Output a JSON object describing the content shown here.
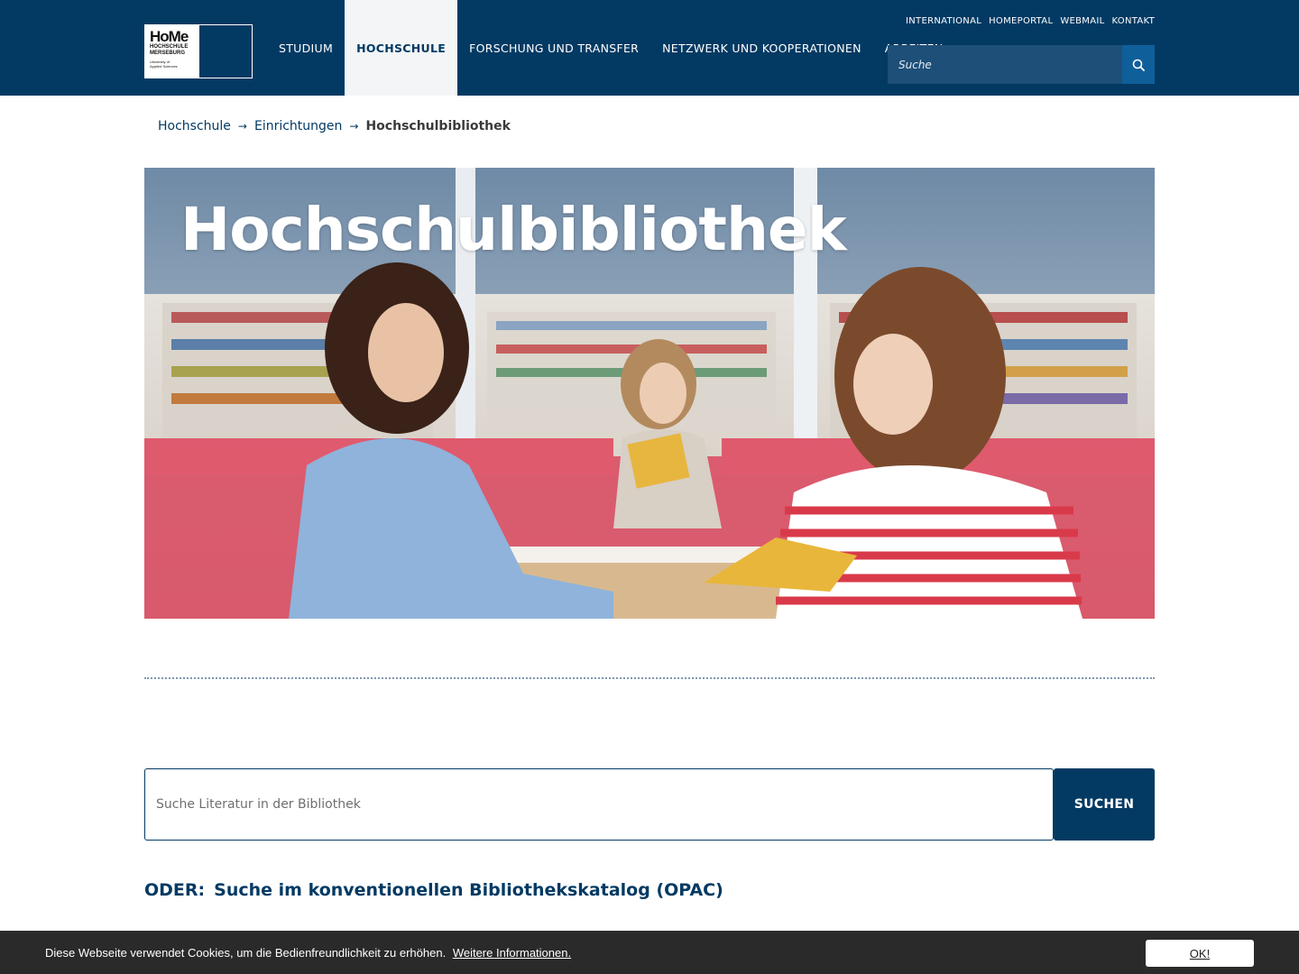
{
  "header": {
    "logo": {
      "title": "HoMe",
      "line1": "HOCHSCHULE",
      "line2": "MERSEBURG",
      "line3": "University of",
      "line4": "Applied Sciences"
    },
    "top_links": [
      "INTERNATIONAL",
      "HOMEPORTAL",
      "WEBMAIL",
      "KONTAKT"
    ],
    "main_nav": [
      {
        "label": "STUDIUM",
        "active": false
      },
      {
        "label": "HOCHSCHULE",
        "active": true
      },
      {
        "label": "FORSCHUNG UND TRANSFER",
        "active": false
      },
      {
        "label": "NETZWERK UND KOOPERATIONEN",
        "active": false
      },
      {
        "label": "ARBEITEN",
        "active": false
      }
    ],
    "search": {
      "placeholder": "Suche",
      "icon": "search-icon"
    }
  },
  "breadcrumb": {
    "items": [
      "Hochschule",
      "Einrichtungen"
    ],
    "current": "Hochschulbibliothek",
    "separator": "→"
  },
  "hero": {
    "title": "Hochschulbibliothek"
  },
  "library_search": {
    "placeholder": "Suche Literatur in der Bibliothek",
    "button": "SUCHEN"
  },
  "opac": {
    "prefix": "ODER:",
    "link": "Suche im konventionellen Bibliothekskatalog (OPAC)"
  },
  "cookie_bar": {
    "text": "Diese Webseite verwendet Cookies, um die Bedienfreundlichkeit zu erhöhen.",
    "link": "Weitere Informationen.",
    "button": "OK!"
  },
  "colors": {
    "primary": "#033a63",
    "search_bg": "#1d4f78",
    "search_button": "#0f5f9a",
    "cookie_bg": "#2a2a2a"
  }
}
